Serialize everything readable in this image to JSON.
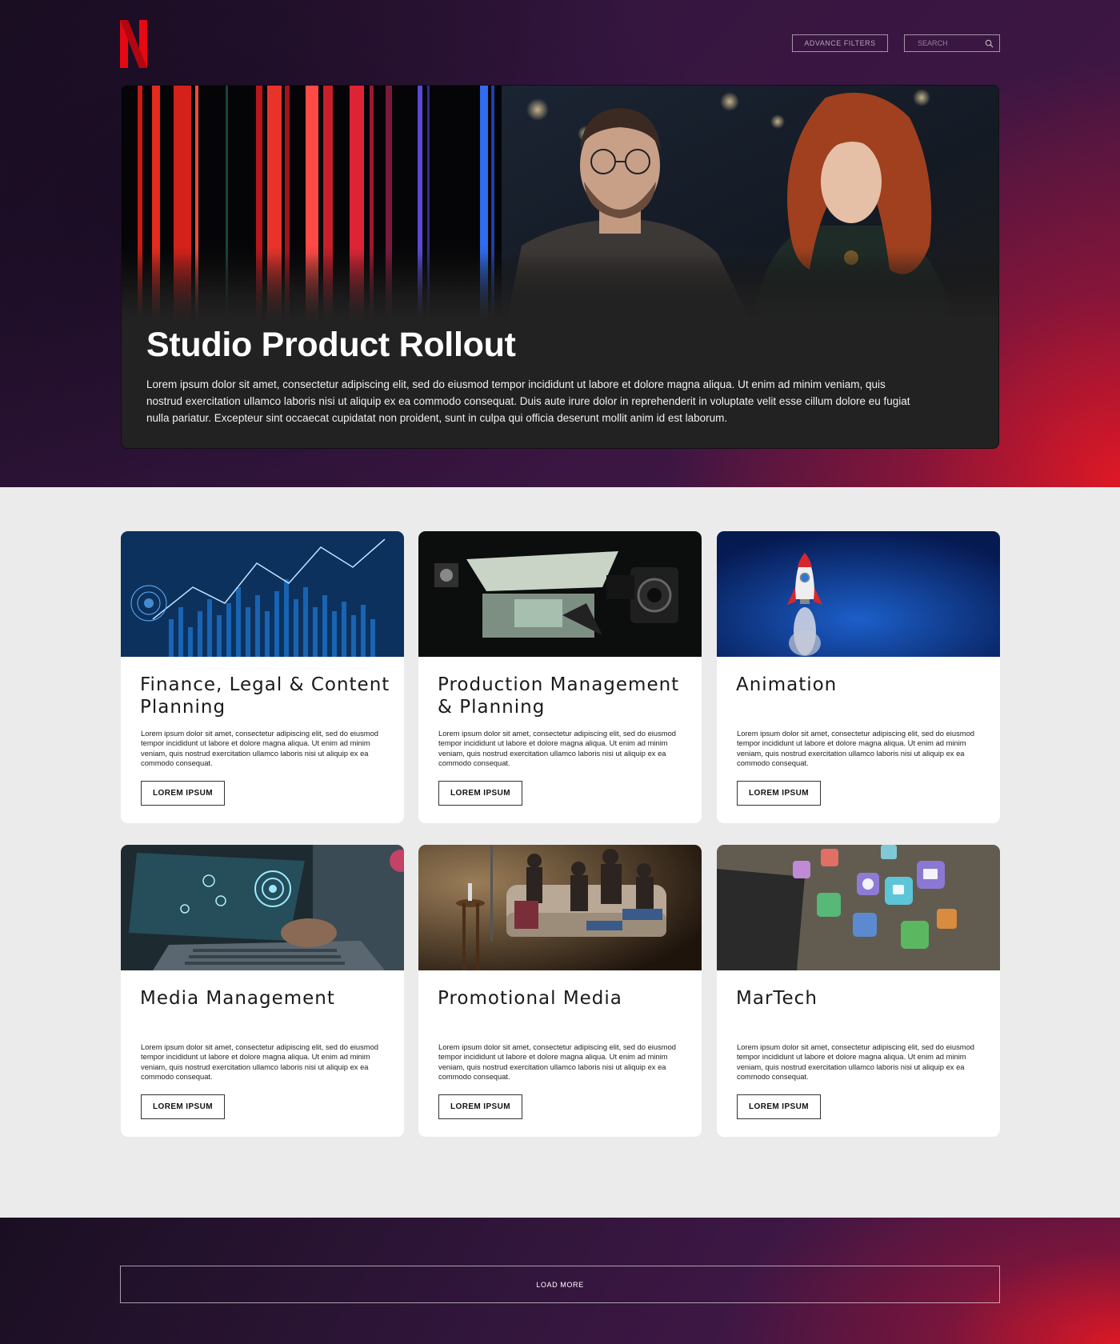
{
  "header": {
    "logo_letter": "N",
    "advance_filters_label": "ADVANCE FILTERS",
    "search_placeholder": "SEARCH",
    "search_icon": "search-icon"
  },
  "hero": {
    "title": "Studio Product Rollout",
    "description": "Lorem ipsum dolor sit amet, consectetur adipiscing elit, sed do eiusmod tempor incididunt ut labore et dolore magna aliqua. Ut enim ad minim veniam, quis nostrud exercitation ullamco laboris nisi ut aliquip ex ea commodo consequat. Duis aute irure dolor in reprehenderit in voluptate velit esse cillum dolore eu fugiat nulla pariatur. Excepteur sint occaecat cupidatat non proident, sunt in culpa qui officia deserunt mollit anim id est laborum."
  },
  "cards": [
    {
      "title": "Finance, Legal & Content Planning",
      "text": "Lorem ipsum dolor sit amet, consectetur adipiscing elit, sed do eiusmod tempor incididunt ut labore et dolore magna aliqua. Ut enim ad minim veniam, quis nostrud exercitation ullamco laboris nisi ut aliquip ex ea commodo consequat.",
      "button": "LOREM IPSUM"
    },
    {
      "title": "Production Management & Planning",
      "text": "Lorem ipsum dolor sit amet, consectetur adipiscing elit, sed do eiusmod tempor incididunt ut labore et dolore magna aliqua. Ut enim ad minim veniam, quis nostrud exercitation ullamco laboris nisi ut aliquip ex ea commodo consequat.",
      "button": "LOREM IPSUM"
    },
    {
      "title": "Animation",
      "text": "Lorem ipsum dolor sit amet, consectetur adipiscing elit, sed do eiusmod tempor incididunt ut labore et dolore magna aliqua. Ut enim ad minim veniam, quis nostrud exercitation ullamco laboris nisi ut aliquip ex ea commodo consequat.",
      "button": "LOREM IPSUM"
    },
    {
      "title": "Media Management",
      "text": "Lorem ipsum dolor sit amet, consectetur adipiscing elit, sed do eiusmod tempor incididunt ut labore et dolore magna aliqua. Ut enim ad minim veniam, quis nostrud exercitation ullamco laboris nisi ut aliquip ex ea commodo consequat.",
      "button": "LOREM IPSUM"
    },
    {
      "title": "Promotional Media",
      "text": "Lorem ipsum dolor sit amet, consectetur adipiscing elit, sed do eiusmod tempor incididunt ut labore et dolore magna aliqua. Ut enim ad minim veniam, quis nostrud exercitation ullamco laboris nisi ut aliquip ex ea commodo consequat.",
      "button": "LOREM IPSUM"
    },
    {
      "title": "MarTech",
      "text": "Lorem ipsum dolor sit amet, consectetur adipiscing elit, sed do eiusmod tempor incididunt ut labore et dolore magna aliqua. Ut enim ad minim veniam, quis nostrud exercitation ullamco laboris nisi ut aliquip ex ea commodo consequat.",
      "button": "LOREM IPSUM"
    }
  ],
  "footer": {
    "load_more_label": "LOAD MORE"
  },
  "colors": {
    "brand_red": "#e50914",
    "deep_purple": "#3c1643",
    "page_gray": "#ebebeb"
  }
}
